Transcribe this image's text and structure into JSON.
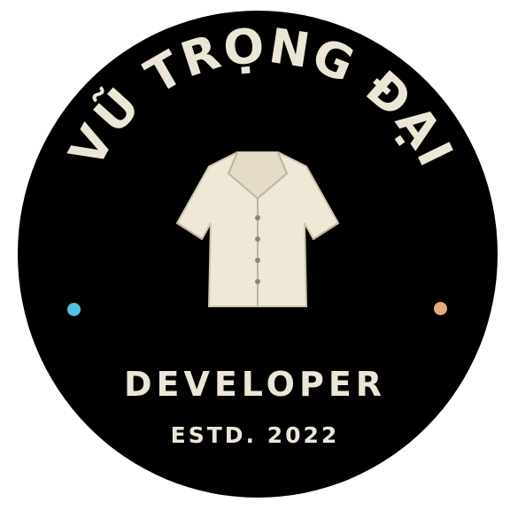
{
  "badge": {
    "name": "VŨ TRỌNG ĐẠI",
    "role": "DEVELOPER",
    "established": "ESTD. 2022"
  },
  "icons": {
    "center": "shirt-icon",
    "left_dot": "dot-icon",
    "right_dot": "dot-icon"
  },
  "colors": {
    "background": "#000000",
    "text": "#ece6d6",
    "shirt": "#efe8d6",
    "left_dot": "#4fc3dc",
    "right_dot": "#e8a87c"
  }
}
